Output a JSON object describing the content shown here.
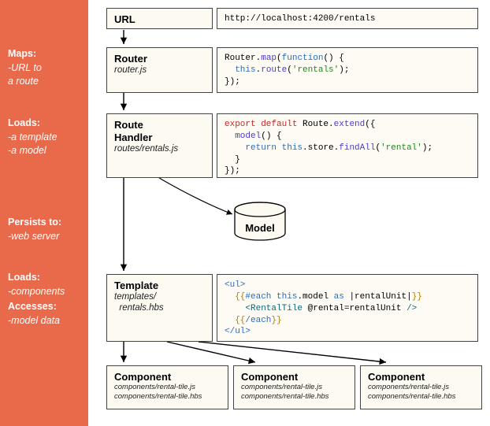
{
  "sidebar": {
    "maps": {
      "title": "Maps:",
      "lines": [
        "-URL to",
        "a route"
      ]
    },
    "loads1": {
      "title": "Loads:",
      "lines": [
        "-a template",
        "-a model"
      ]
    },
    "persists": {
      "title": "Persists to:",
      "lines": [
        "-web server"
      ]
    },
    "loads2": {
      "title": "Loads:",
      "lines": [
        "-components"
      ]
    },
    "accesses": {
      "title": "Accesses:",
      "lines": [
        "-model data"
      ]
    }
  },
  "url": {
    "label": "URL",
    "value": "http://localhost:4200/rentals"
  },
  "router": {
    "label": "Router",
    "file": "router.js",
    "code": "Router.map(function() {\n  this.route('rentals');\n});",
    "tokens": [
      "Router",
      ".",
      "map",
      "(",
      "function",
      "() {",
      "\n  ",
      "this",
      ".",
      "route",
      "(",
      "'rentals'",
      ");",
      "\n});"
    ]
  },
  "route_handler": {
    "label": "Route Handler",
    "file": "routes/rentals.js",
    "code": "export default Route.extend({\n  model() {\n    return this.store.findAll('rental');\n  }\n});"
  },
  "model": {
    "label": "Model"
  },
  "template": {
    "label": "Template",
    "file": "templates/\n  rentals.hbs",
    "code": "<ul>\n  {{#each this.model as |rentalUnit|}}\n    <RentalTile @rental=rentalUnit />\n  {{/each}}\n</ul>"
  },
  "component": {
    "label": "Component",
    "files": "components/rental-tile.js\ncomponents/rental-tile.hbs"
  }
}
